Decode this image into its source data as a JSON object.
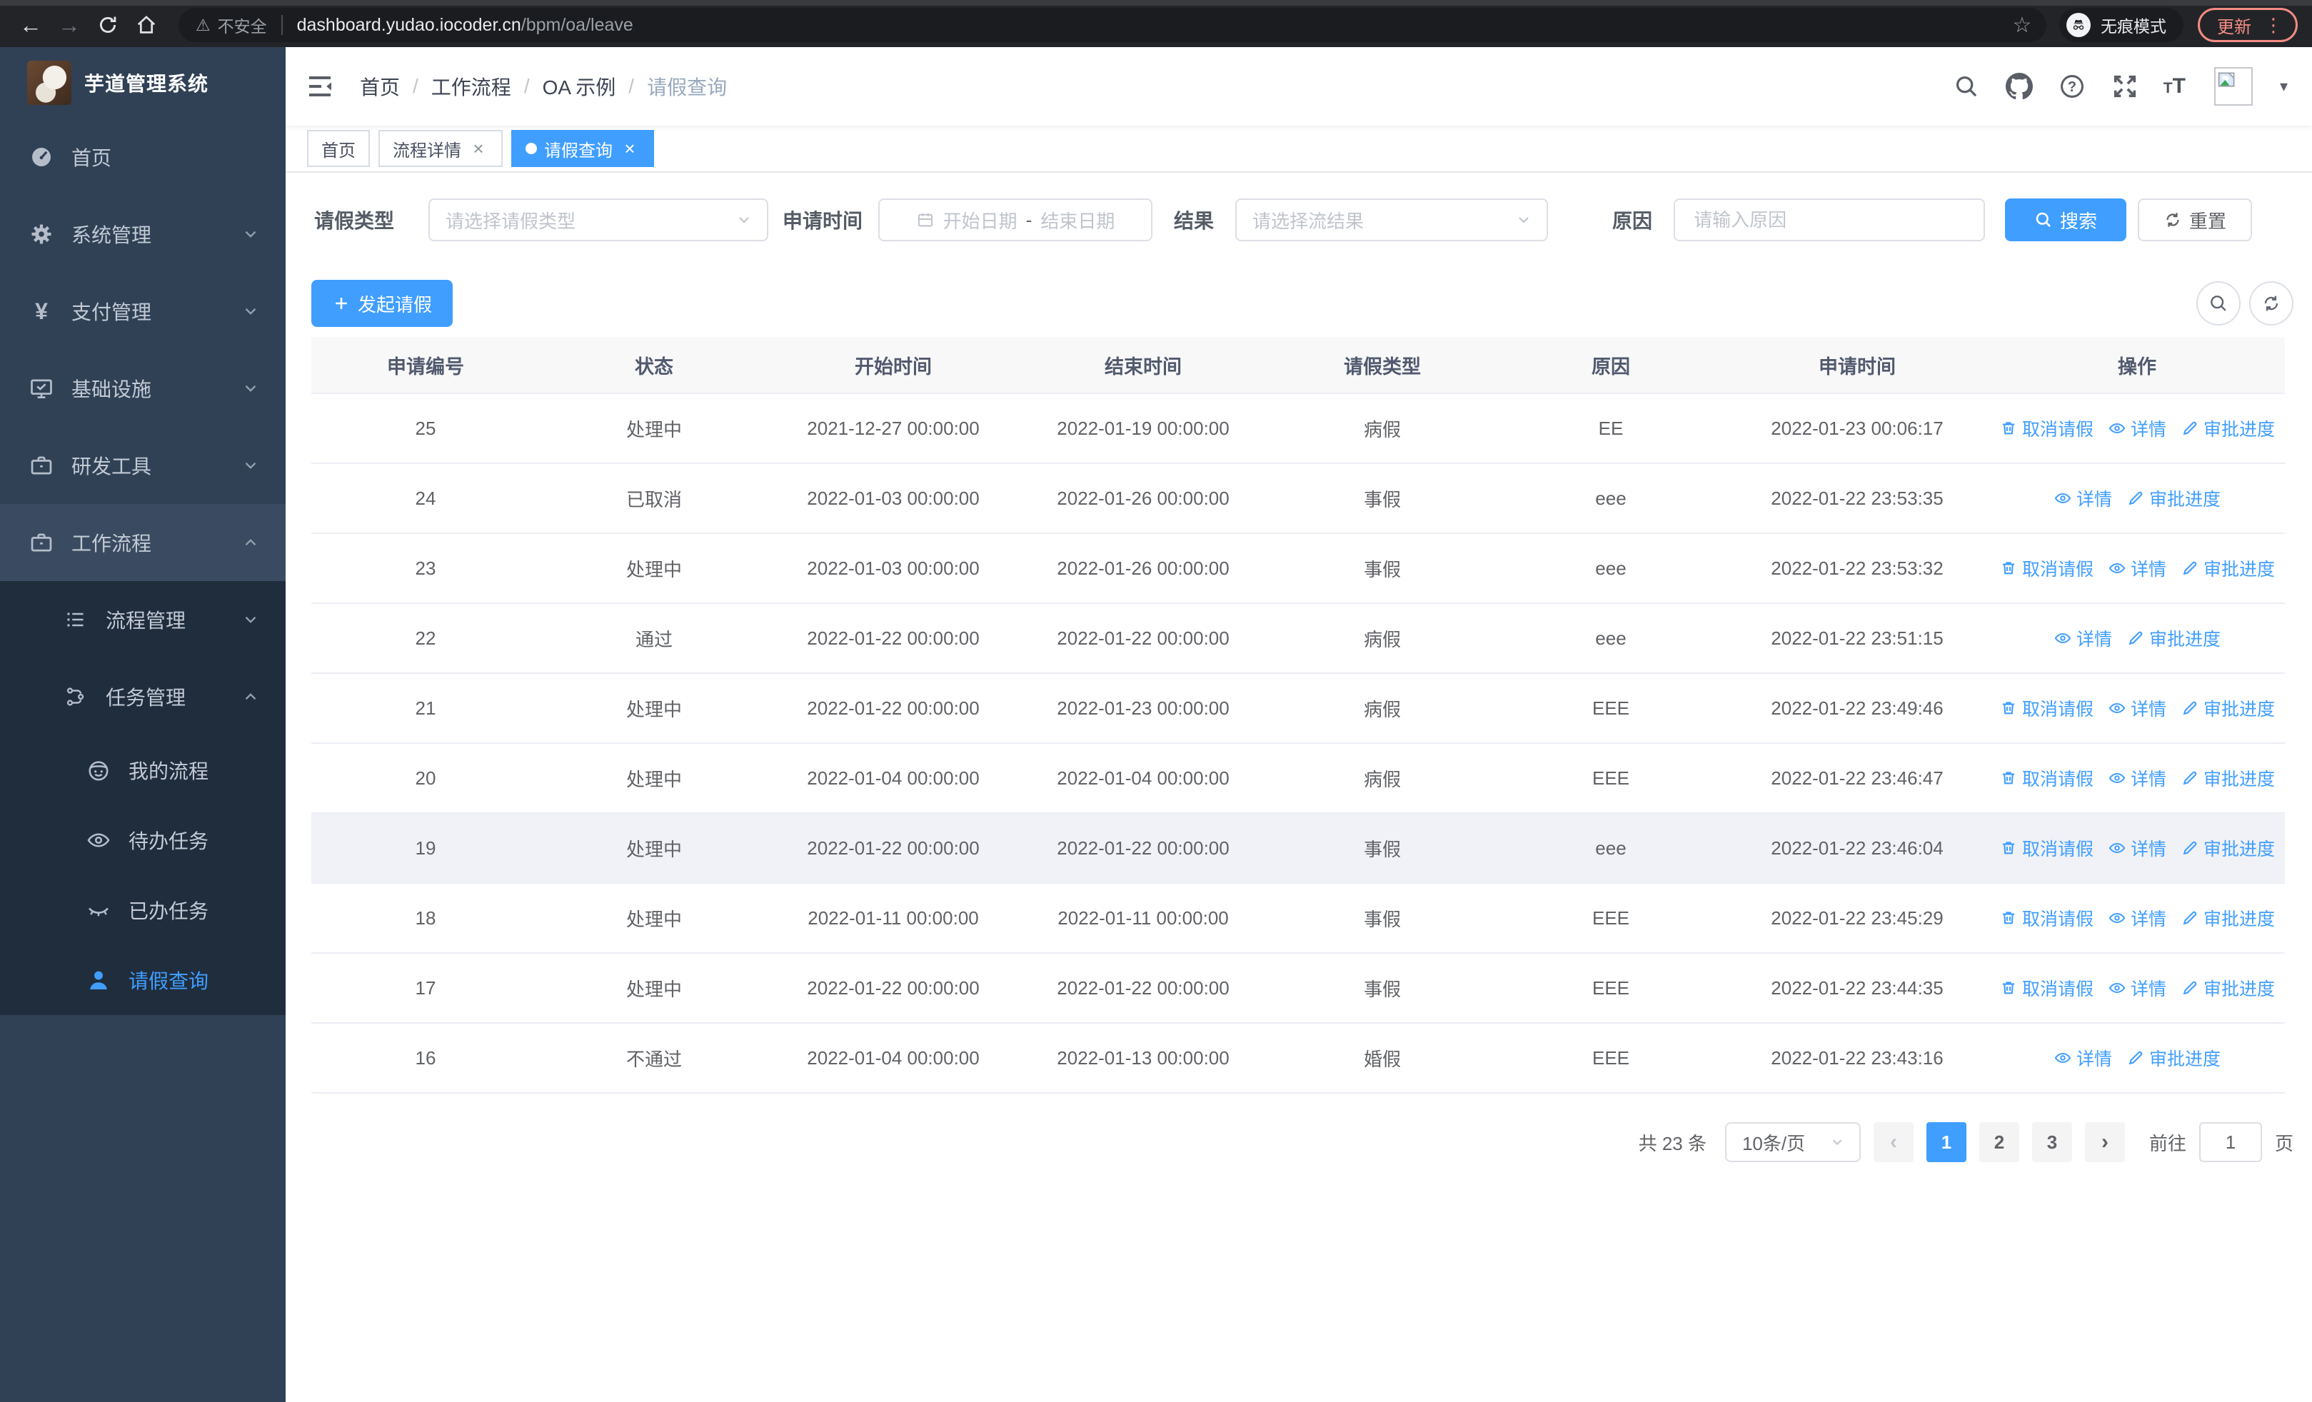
{
  "browser": {
    "security_label": "不安全",
    "url_host": "dashboard.yudao.iocoder.cn",
    "url_path": "/bpm/oa/leave",
    "incognito_label": "无痕模式",
    "update_label": "更新"
  },
  "sidebar": {
    "title": "芋道管理系统",
    "items": [
      {
        "label": "首页",
        "icon": "dashboard-icon",
        "level": 1
      },
      {
        "label": "系统管理",
        "icon": "gear-icon",
        "level": 1,
        "chevron": "down"
      },
      {
        "label": "支付管理",
        "icon": "yen-icon",
        "level": 1,
        "chevron": "down"
      },
      {
        "label": "基础设施",
        "icon": "monitor-icon",
        "level": 1,
        "chevron": "down"
      },
      {
        "label": "研发工具",
        "icon": "briefcase-icon",
        "level": 1,
        "chevron": "down"
      },
      {
        "label": "工作流程",
        "icon": "briefcase-icon",
        "level": 1,
        "chevron": "up",
        "open": true
      },
      {
        "label": "流程管理",
        "icon": "list-icon",
        "level": 2,
        "chevron": "down"
      },
      {
        "label": "任务管理",
        "icon": "flow-icon",
        "level": 2,
        "chevron": "up"
      },
      {
        "label": "我的流程",
        "icon": "face-icon",
        "level": 3
      },
      {
        "label": "待办任务",
        "icon": "eye-icon",
        "level": 3
      },
      {
        "label": "已办任务",
        "icon": "eye-closed-icon",
        "level": 3
      },
      {
        "label": "请假查询",
        "icon": "user-icon",
        "level": 3,
        "active": true
      }
    ]
  },
  "header": {
    "breadcrumb": [
      "首页",
      "工作流程",
      "OA 示例",
      "请假查询"
    ]
  },
  "tabs": [
    {
      "label": "首页",
      "closable": false,
      "active": false
    },
    {
      "label": "流程详情",
      "closable": true,
      "active": false
    },
    {
      "label": "请假查询",
      "closable": true,
      "active": true
    }
  ],
  "filters": {
    "leave_type": {
      "label": "请假类型",
      "placeholder": "请选择请假类型"
    },
    "apply_time": {
      "label": "申请时间",
      "start_placeholder": "开始日期",
      "separator": "-",
      "end_placeholder": "结束日期"
    },
    "result": {
      "label": "结果",
      "placeholder": "请选择流结果"
    },
    "reason": {
      "label": "原因",
      "placeholder": "请输入原因"
    },
    "search_label": "搜索",
    "reset_label": "重置"
  },
  "toolbar": {
    "create_label": "发起请假"
  },
  "table": {
    "columns": [
      "申请编号",
      "状态",
      "开始时间",
      "结束时间",
      "请假类型",
      "原因",
      "申请时间",
      "操作"
    ],
    "action_labels": {
      "cancel": "取消请假",
      "detail": "详情",
      "progress": "审批进度"
    },
    "rows": [
      {
        "id": "25",
        "status": "处理中",
        "start": "2021-12-27 00:00:00",
        "end": "2022-01-19 00:00:00",
        "type": "病假",
        "reason": "EE",
        "applied": "2022-01-23 00:06:17",
        "actions": [
          "cancel",
          "detail",
          "progress"
        ]
      },
      {
        "id": "24",
        "status": "已取消",
        "start": "2022-01-03 00:00:00",
        "end": "2022-01-26 00:00:00",
        "type": "事假",
        "reason": "eee",
        "applied": "2022-01-22 23:53:35",
        "actions": [
          "detail",
          "progress"
        ]
      },
      {
        "id": "23",
        "status": "处理中",
        "start": "2022-01-03 00:00:00",
        "end": "2022-01-26 00:00:00",
        "type": "事假",
        "reason": "eee",
        "applied": "2022-01-22 23:53:32",
        "actions": [
          "cancel",
          "detail",
          "progress"
        ]
      },
      {
        "id": "22",
        "status": "通过",
        "start": "2022-01-22 00:00:00",
        "end": "2022-01-22 00:00:00",
        "type": "病假",
        "reason": "eee",
        "applied": "2022-01-22 23:51:15",
        "actions": [
          "detail",
          "progress"
        ]
      },
      {
        "id": "21",
        "status": "处理中",
        "start": "2022-01-22 00:00:00",
        "end": "2022-01-23 00:00:00",
        "type": "病假",
        "reason": "EEE",
        "applied": "2022-01-22 23:49:46",
        "actions": [
          "cancel",
          "detail",
          "progress"
        ]
      },
      {
        "id": "20",
        "status": "处理中",
        "start": "2022-01-04 00:00:00",
        "end": "2022-01-04 00:00:00",
        "type": "病假",
        "reason": "EEE",
        "applied": "2022-01-22 23:46:47",
        "actions": [
          "cancel",
          "detail",
          "progress"
        ]
      },
      {
        "id": "19",
        "status": "处理中",
        "start": "2022-01-22 00:00:00",
        "end": "2022-01-22 00:00:00",
        "type": "事假",
        "reason": "eee",
        "applied": "2022-01-22 23:46:04",
        "actions": [
          "cancel",
          "detail",
          "progress"
        ],
        "highlight": true
      },
      {
        "id": "18",
        "status": "处理中",
        "start": "2022-01-11 00:00:00",
        "end": "2022-01-11 00:00:00",
        "type": "事假",
        "reason": "EEE",
        "applied": "2022-01-22 23:45:29",
        "actions": [
          "cancel",
          "detail",
          "progress"
        ]
      },
      {
        "id": "17",
        "status": "处理中",
        "start": "2022-01-22 00:00:00",
        "end": "2022-01-22 00:00:00",
        "type": "事假",
        "reason": "EEE",
        "applied": "2022-01-22 23:44:35",
        "actions": [
          "cancel",
          "detail",
          "progress"
        ]
      },
      {
        "id": "16",
        "status": "不通过",
        "start": "2022-01-04 00:00:00",
        "end": "2022-01-13 00:00:00",
        "type": "婚假",
        "reason": "EEE",
        "applied": "2022-01-22 23:43:16",
        "actions": [
          "detail",
          "progress"
        ]
      }
    ]
  },
  "pagination": {
    "total_label": "共 23 条",
    "page_size": "10条/页",
    "pages": [
      "1",
      "2",
      "3"
    ],
    "active_page": "1",
    "goto_label": "前往",
    "goto_value": "1",
    "page_suffix": "页"
  },
  "colors": {
    "primary": "#409EFF",
    "sidebar_bg": "#304156",
    "submenu_bg": "#1f2d3d",
    "update_chip": "#f28b82"
  }
}
